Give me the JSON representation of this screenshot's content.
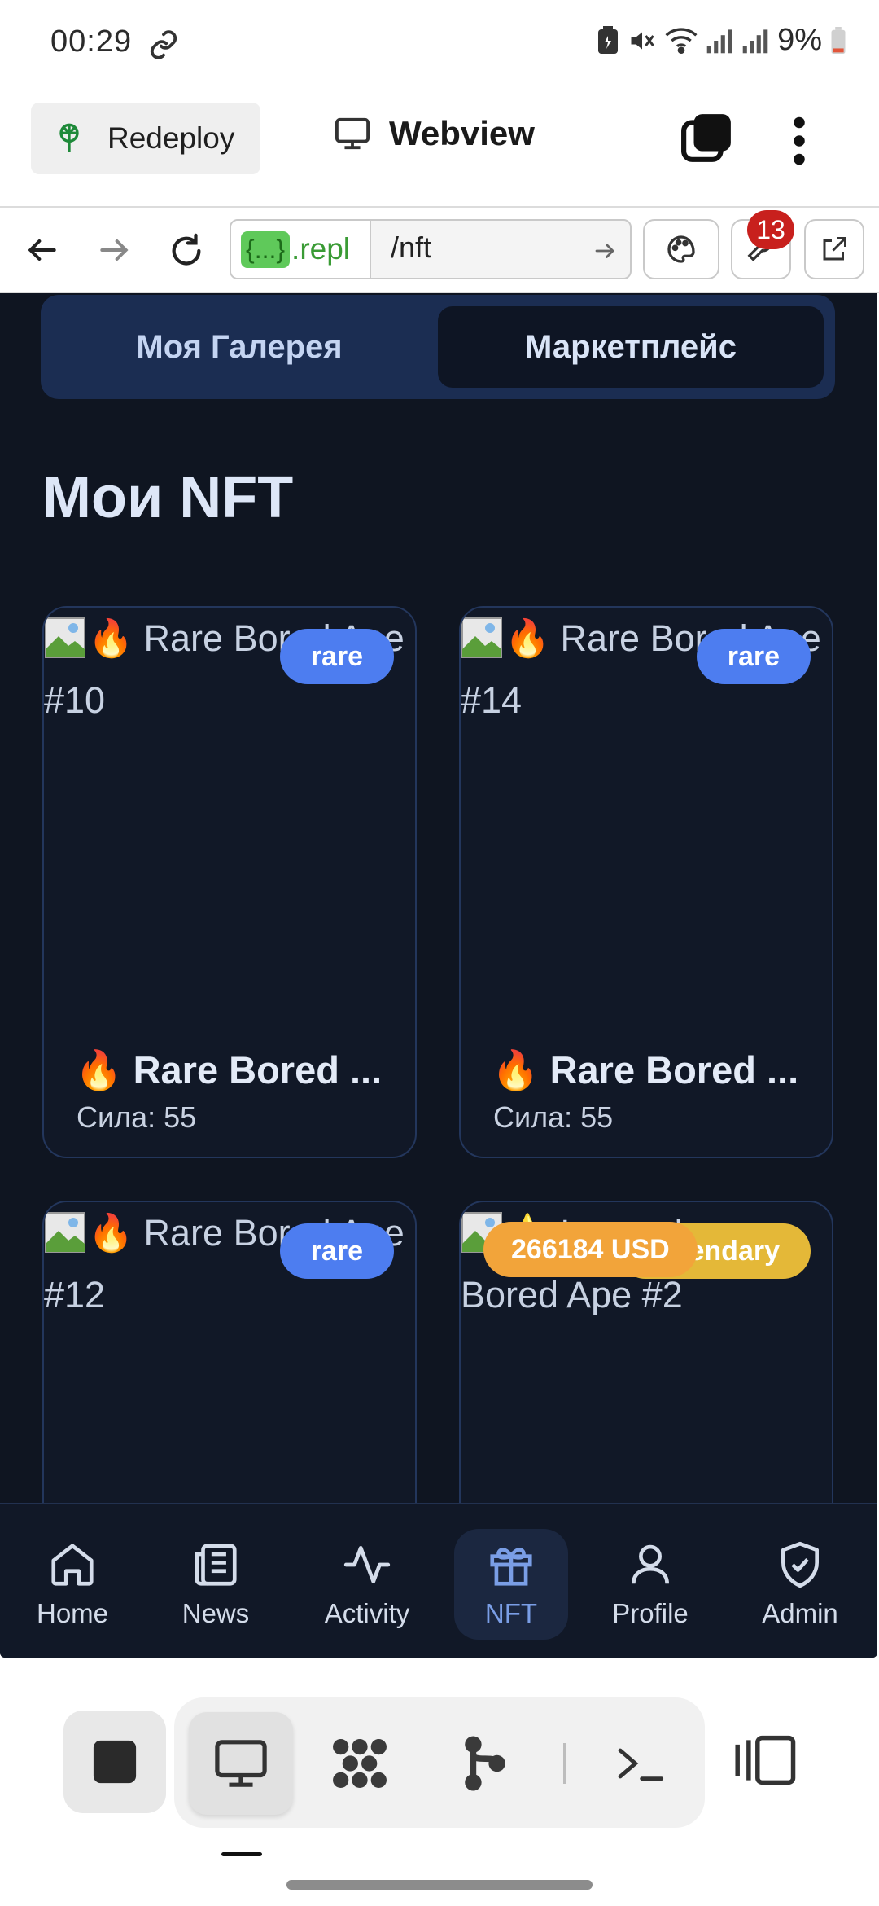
{
  "status_bar": {
    "time": "00:29",
    "battery": "9%"
  },
  "replit_bar": {
    "redeploy_label": "Redeploy",
    "webview_label": "Webview"
  },
  "url_bar": {
    "domain_badge": "{...}",
    "domain_suffix": ".repl",
    "path": "/nft",
    "notification_count": "13"
  },
  "app": {
    "tabs": [
      {
        "label": "Моя Галерея"
      },
      {
        "label": "Маркетплейс"
      }
    ],
    "title": "Мои NFT",
    "cards": [
      {
        "alt": "🔥 Rare Bored Ape #10",
        "rarity": "rare",
        "name": "🔥 Rare Bored ...",
        "power": "Сила: 55"
      },
      {
        "alt": "🔥 Rare Bored Ape #14",
        "rarity": "rare",
        "name": "🔥 Rare Bored ...",
        "power": "Сила: 55"
      },
      {
        "alt": "🔥 Rare Bored Ape #12",
        "rarity": "rare"
      },
      {
        "alt": "⭐ Legendary Bored Ape #2",
        "rarity": "legendary",
        "price": "266184 USD"
      }
    ],
    "bottom_nav": [
      {
        "label": "Home",
        "icon": "home-icon"
      },
      {
        "label": "News",
        "icon": "news-icon"
      },
      {
        "label": "Activity",
        "icon": "activity-icon"
      },
      {
        "label": "NFT",
        "icon": "gift-icon",
        "active": true
      },
      {
        "label": "Profile",
        "icon": "user-icon"
      },
      {
        "label": "Admin",
        "icon": "shield-check-icon"
      }
    ]
  },
  "colors": {
    "app_bg": "#0f1521",
    "accent": "#4d7df0",
    "legendary": "#e4b838",
    "price": "#f2a43a",
    "nav_active": "#7a9ee6"
  }
}
